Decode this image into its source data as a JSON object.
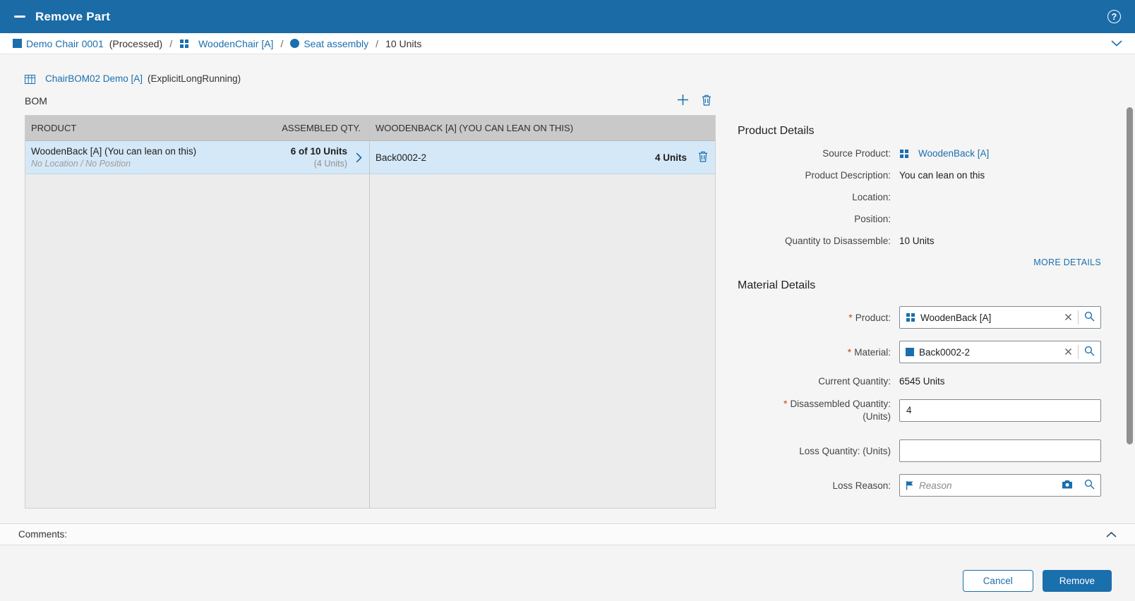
{
  "header": {
    "title": "Remove Part",
    "help_glyph": "?"
  },
  "breadcrumb": {
    "separator": "/",
    "sfc_label": "Demo Chair 0001",
    "sfc_status": "(Processed)",
    "product_label": "WoodenChair [A]",
    "operation_label": "Seat assembly",
    "quantity_label": "10 Units"
  },
  "bom": {
    "bom_link_label": "ChairBOM02 Demo [A]",
    "bom_link_suffix": "(ExplicitLongRunning)",
    "section_label": "BOM",
    "product_table": {
      "header_product": "PRODUCT",
      "header_qty": "ASSEMBLED QTY.",
      "row_title": "WoodenBack [A] (You can lean on this)",
      "row_location": "No Location / No Position",
      "row_qty": "6 of 10 Units",
      "row_qty_note": "(4 Units)"
    },
    "component_table": {
      "header": "WOODENBACK [A] (YOU CAN LEAN ON THIS)",
      "row_title": "Back0002-2",
      "row_qty": "4 Units"
    }
  },
  "product_details": {
    "title": "Product Details",
    "source_product_label": "Source Product:",
    "source_product_value": "WoodenBack [A]",
    "description_label": "Product Description:",
    "description_value": "You can lean on this",
    "location_label": "Location:",
    "location_value": "",
    "position_label": "Position:",
    "position_value": "",
    "qty_label": "Quantity to Disassemble:",
    "qty_value": "10 Units",
    "more_details_label": "MORE DETAILS"
  },
  "material_details": {
    "title": "Material Details",
    "required_marker": "*",
    "product_label": "Product:",
    "product_value": "WoodenBack [A]",
    "material_label": "Material:",
    "material_value": "Back0002-2",
    "current_qty_label": "Current Quantity:",
    "current_qty_value": "6545 Units",
    "disassembled_label": "Disassembled Quantity:",
    "disassembled_label_units": "(Units)",
    "disassembled_value": "4",
    "loss_qty_label": "Loss Quantity: (Units)",
    "loss_qty_value": "",
    "loss_reason_label": "Loss Reason:",
    "loss_reason_placeholder": "Reason"
  },
  "footer": {
    "comments_label": "Comments:",
    "cancel_label": "Cancel",
    "remove_label": "Remove"
  },
  "colors": {
    "header_bg": "#1b6ba7",
    "link": "#1a6fad",
    "selected_row_bg": "#d5e8f7",
    "table_header_bg": "#c9c9c9",
    "required": "#c14601"
  }
}
